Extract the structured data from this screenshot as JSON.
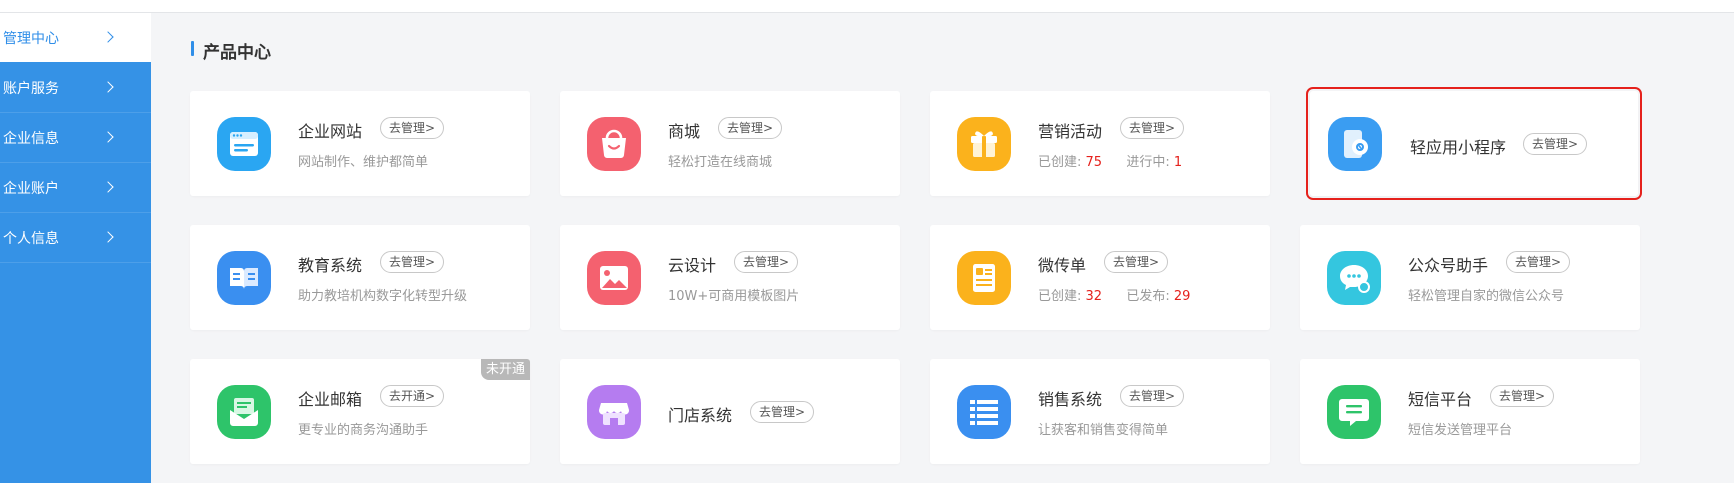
{
  "sidebar": {
    "items": [
      {
        "label": "管理中心",
        "active": true
      },
      {
        "label": "账户服务"
      },
      {
        "label": "企业信息"
      },
      {
        "label": "企业账户"
      },
      {
        "label": "个人信息"
      }
    ]
  },
  "section": {
    "title": "产品中心"
  },
  "colors": {
    "accent": "#3592e6",
    "highlight": "#e5211c",
    "stat": "#e5211c"
  },
  "products": {
    "website": {
      "title": "企业网站",
      "button": "去管理>",
      "desc": "网站制作、维护都简单",
      "icon": "browser-window-icon"
    },
    "mall": {
      "title": "商城",
      "button": "去管理>",
      "desc": "轻松打造在线商城",
      "icon": "shopping-bag-icon"
    },
    "marketing": {
      "title": "营销活动",
      "button": "去管理>",
      "stat1_label": "已创建:",
      "stat1_value": "75",
      "stat2_label": "进行中:",
      "stat2_value": "1",
      "icon": "gift-box-icon"
    },
    "miniapp": {
      "title": "轻应用小程序",
      "button": "去管理>",
      "icon": "mini-program-icon"
    },
    "education": {
      "title": "教育系统",
      "button": "去管理>",
      "desc": "助力教培机构数字化转型升级",
      "icon": "open-book-icon"
    },
    "clouddesign": {
      "title": "云设计",
      "button": "去管理>",
      "desc": "10W+可商用模板图片",
      "icon": "image-picture-icon"
    },
    "flyer": {
      "title": "微传单",
      "button": "去管理>",
      "stat1_label": "已创建:",
      "stat1_value": "32",
      "stat2_label": "已发布:",
      "stat2_value": "29",
      "icon": "flyer-page-icon"
    },
    "wechat": {
      "title": "公众号助手",
      "button": "去管理>",
      "desc": "轻松管理自家的微信公众号",
      "icon": "chat-bubble-gear-icon"
    },
    "mail": {
      "title": "企业邮箱",
      "button": "去开通>",
      "desc": "更专业的商务沟通助手",
      "badge": "未开通",
      "icon": "mail-tray-icon"
    },
    "store": {
      "title": "门店系统",
      "button": "去管理>",
      "icon": "storefront-icon"
    },
    "sales": {
      "title": "销售系统",
      "button": "去管理>",
      "desc": "让获客和销售变得简单",
      "icon": "list-icon"
    },
    "sms": {
      "title": "短信平台",
      "button": "去管理>",
      "desc": "短信发送管理平台",
      "icon": "message-bubble-icon"
    }
  }
}
